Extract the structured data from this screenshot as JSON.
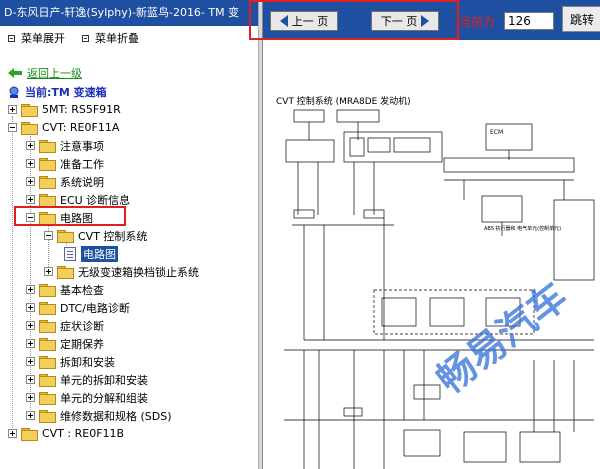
{
  "window": {
    "title": "D-东风日产-轩逸(Sylphy)-新蓝鸟-2016- TM 变"
  },
  "toolbar": {
    "expand_label": "菜单展开",
    "collapse_label": "菜单折叠"
  },
  "nav": {
    "back_label": "返回上一级",
    "current_label": "当前:TM 变速箱"
  },
  "tree": {
    "n1": "5MT: RS5F91R",
    "n2": "CVT: RE0F11A",
    "n3": "注意事项",
    "n4": "准备工作",
    "n5": "系统说明",
    "n6": "ECU 诊断信息",
    "n7": "电路图",
    "n8": "CVT 控制系统",
    "n9": "电路图",
    "n10": "无级变速箱换档锁止系统",
    "n11": "基本检查",
    "n12": "DTC/电路诊断",
    "n13": "症状诊断",
    "n14": "定期保养",
    "n15": "拆卸和安装",
    "n16": "单元的拆卸和安装",
    "n17": "单元的分解和组装",
    "n18": "维修数据和规格 (SDS)",
    "n19": "CVT : RE0F11B"
  },
  "pager": {
    "prev_label": "上一 页",
    "next_label": "下一 页",
    "current_page_label": "当前为",
    "page_value": "126",
    "jump_label": "跳转"
  },
  "diagram": {
    "title": "CVT 控制系统 (MRA8DE 发动机)",
    "ecm_label": "ECM",
    "abs_label": "ABS 执行器和 电气单元(控制单元)",
    "wm1": "畅易汽车"
  },
  "colors": {
    "accent": "#1e4fa0",
    "highlight": "#e02020",
    "link": "#1a8a1a"
  }
}
